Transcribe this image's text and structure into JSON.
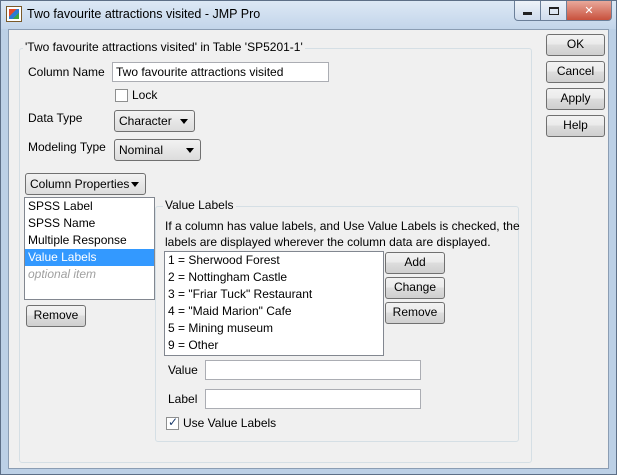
{
  "window": {
    "title": "Two favourite attractions visited - JMP Pro",
    "minimize_label": "",
    "maximize_label": "",
    "close_label": "✕"
  },
  "group": {
    "title": "'Two favourite attractions visited' in Table 'SP5201-1'"
  },
  "fields": {
    "column_name_label": "Column Name",
    "column_name_value": "Two favourite attractions visited",
    "lock_label": "Lock",
    "data_type_label": "Data Type",
    "data_type_value": "Character",
    "modeling_type_label": "Modeling Type",
    "modeling_type_value": "Nominal"
  },
  "column_properties": {
    "button_label": "Column Properties",
    "items": [
      {
        "label": "SPSS Label"
      },
      {
        "label": "SPSS Name"
      },
      {
        "label": "Multiple Response"
      },
      {
        "label": "Value Labels"
      },
      {
        "label": "optional item"
      }
    ],
    "selected_index": 3,
    "remove_label": "Remove"
  },
  "value_labels": {
    "title": "Value Labels",
    "info_line1": "If a column has value labels, and Use Value Labels is checked, the",
    "info_line2": "labels are displayed wherever the column data are displayed.",
    "items": [
      {
        "label": "1 = Sherwood Forest"
      },
      {
        "label": "2 = Nottingham Castle"
      },
      {
        "label": "3 = \"Friar Tuck\" Restaurant"
      },
      {
        "label": "4 = \"Maid Marion\" Cafe"
      },
      {
        "label": "5 = Mining museum"
      },
      {
        "label": "9 = Other"
      }
    ],
    "add_label": "Add",
    "change_label": "Change",
    "remove_label": "Remove",
    "value_label": "Value",
    "value_input": "",
    "label_label": "Label",
    "label_input": "",
    "use_value_labels_label": "Use Value Labels",
    "use_value_labels_checked": true
  },
  "actions": {
    "ok_label": "OK",
    "cancel_label": "Cancel",
    "apply_label": "Apply",
    "help_label": "Help"
  }
}
